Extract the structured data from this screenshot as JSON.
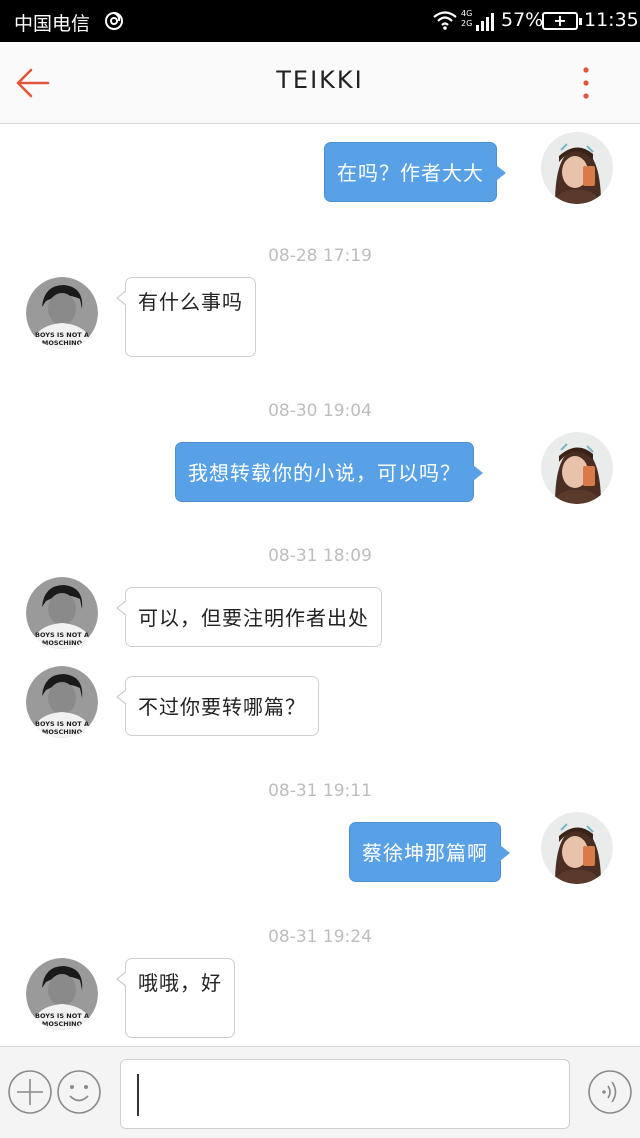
{
  "statusbar": {
    "carrier": "中国电信",
    "network": "4G 2G",
    "battery": "57%",
    "time": "11:35"
  },
  "header": {
    "title": "TEIKKI",
    "back_icon": "arrow-left-icon",
    "menu_icon": "more-vertical-icon"
  },
  "colors": {
    "accent": "#e2553b",
    "bubble_out": "#58a1e6",
    "timestamp": "#bdbdbd"
  },
  "messages": [
    {
      "from": "me",
      "text": "在吗？作者大大"
    },
    {
      "timestamp": "08-28 17:19"
    },
    {
      "from": "other",
      "text": "有什么事吗"
    },
    {
      "timestamp": "08-30 19:04"
    },
    {
      "from": "me",
      "text": "我想转载你的小说，可以吗？"
    },
    {
      "timestamp": "08-31 18:09"
    },
    {
      "from": "other",
      "text": "可以，但要注明作者出处"
    },
    {
      "from": "other",
      "text": "不过你要转哪篇？"
    },
    {
      "timestamp": "08-31 19:11"
    },
    {
      "from": "me",
      "text": "蔡徐坤那篇啊"
    },
    {
      "timestamp": "08-31 19:24"
    },
    {
      "from": "other",
      "text": "哦哦，好"
    }
  ],
  "other_avatar_shirt": "BOYS IS NOT A MOSCHINO",
  "inputbar": {
    "add_icon": "plus-circle-icon",
    "emoji_icon": "smiley-icon",
    "voice_icon": "voice-icon",
    "placeholder": ""
  }
}
